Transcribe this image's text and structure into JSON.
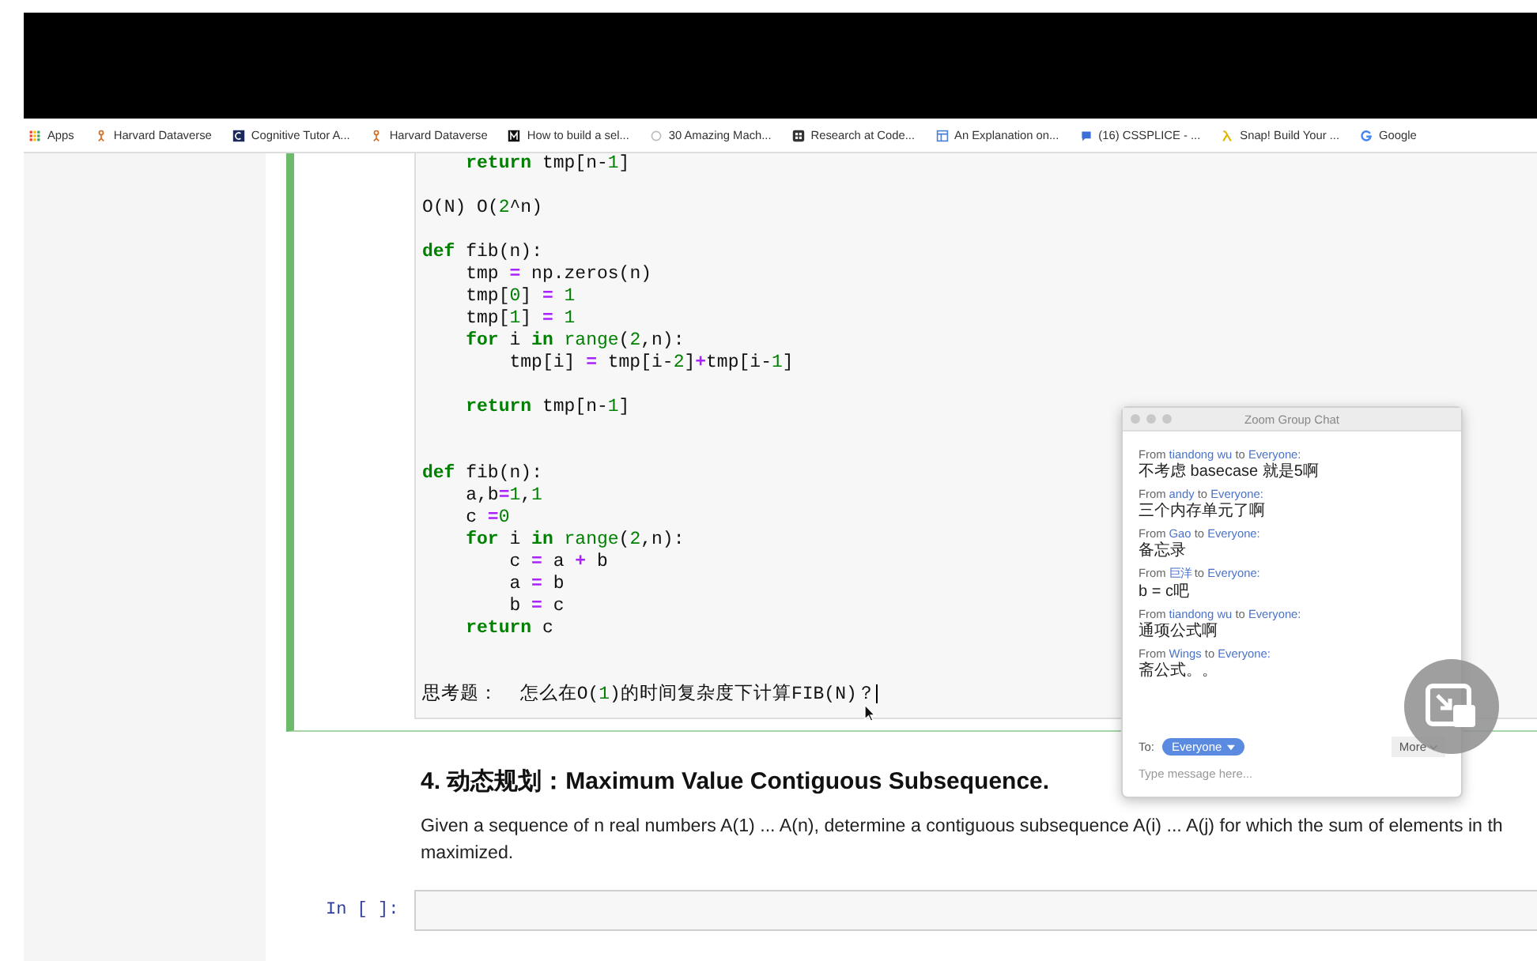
{
  "bookmarks": [
    {
      "kind": "grid",
      "label": "Apps"
    },
    {
      "kind": "figure",
      "label": "Harvard Dataverse"
    },
    {
      "kind": "tile",
      "label": "Cognitive Tutor A..."
    },
    {
      "kind": "figure",
      "label": "Harvard Dataverse"
    },
    {
      "kind": "monogram",
      "label": "How to build a sel..."
    },
    {
      "kind": "ring",
      "label": "30 Amazing Mach..."
    },
    {
      "kind": "dots",
      "label": "Research at Code..."
    },
    {
      "kind": "window",
      "label": "An Explanation on..."
    },
    {
      "kind": "chat",
      "label": "(16) CSSPLICE - ..."
    },
    {
      "kind": "lambda",
      "label": "Snap! Build Your ..."
    },
    {
      "kind": "g",
      "label": "Google"
    }
  ],
  "code_cell": {
    "lines": [
      {
        "kind": "code",
        "text": "    return tmp[n-1]"
      },
      {
        "kind": "blank"
      },
      {
        "kind": "code",
        "text": "O(N) O(2^n)"
      },
      {
        "kind": "blank"
      },
      {
        "kind": "code",
        "text": "def fib(n):"
      },
      {
        "kind": "code",
        "text": "    tmp = np.zeros(n)"
      },
      {
        "kind": "code",
        "text": "    tmp[0] = 1"
      },
      {
        "kind": "code",
        "text": "    tmp[1] = 1"
      },
      {
        "kind": "code",
        "text": "    for i in range(2,n):"
      },
      {
        "kind": "code",
        "text": "        tmp[i] = tmp[i-2]+tmp[i-1]"
      },
      {
        "kind": "blank"
      },
      {
        "kind": "code",
        "text": "    return tmp[n-1]"
      },
      {
        "kind": "blank"
      },
      {
        "kind": "blank"
      },
      {
        "kind": "code",
        "text": "def fib(n):"
      },
      {
        "kind": "code",
        "text": "    a,b=1,1"
      },
      {
        "kind": "code",
        "text": "    c =0"
      },
      {
        "kind": "code",
        "text": "    for i in range(2,n):"
      },
      {
        "kind": "code",
        "text": "        c = a + b"
      },
      {
        "kind": "code",
        "text": "        a = b"
      },
      {
        "kind": "code",
        "text": "        b = c"
      },
      {
        "kind": "code",
        "text": "    return c"
      },
      {
        "kind": "blank"
      },
      {
        "kind": "blank"
      },
      {
        "kind": "code",
        "text": "思考题：  怎么在O(1)的时间复杂度下计算FIB(N)？"
      }
    ]
  },
  "markdown": {
    "heading": "4. 动态规划：Maximum Value Contiguous Subsequence.",
    "paragraph": "Given a sequence of n real numbers A(1) ... A(n), determine a contiguous subsequence A(i) ... A(j) for which the sum of elements in th\nmaximized."
  },
  "input_cell": {
    "prompt": "In [ ]:"
  },
  "chat": {
    "title": "Zoom Group Chat",
    "messages": [
      {
        "from": "From",
        "sender": "tiandong wu",
        "to": "to",
        "recipient": "Everyone:",
        "text": "不考虑 basecase 就是5啊"
      },
      {
        "from": "From",
        "sender": "andy",
        "to": "to",
        "recipient": "Everyone:",
        "text": "三个内存单元了啊"
      },
      {
        "from": "From",
        "sender": "Gao",
        "to": "to",
        "recipient": "Everyone:",
        "text": "备忘录"
      },
      {
        "from": "From",
        "sender": "巨洋",
        "to": "to",
        "recipient": "Everyone:",
        "text": "b = c吧"
      },
      {
        "from": "From",
        "sender": "tiandong wu",
        "to": "to",
        "recipient": "Everyone:",
        "text": "通项公式啊"
      },
      {
        "from": "From",
        "sender": "Wings",
        "to": "to",
        "recipient": "Everyone:",
        "text": "斋公式。。"
      }
    ],
    "to_label": "To:",
    "recipient_select": "Everyone",
    "more_button": "More",
    "message_placeholder": "Type message here..."
  }
}
